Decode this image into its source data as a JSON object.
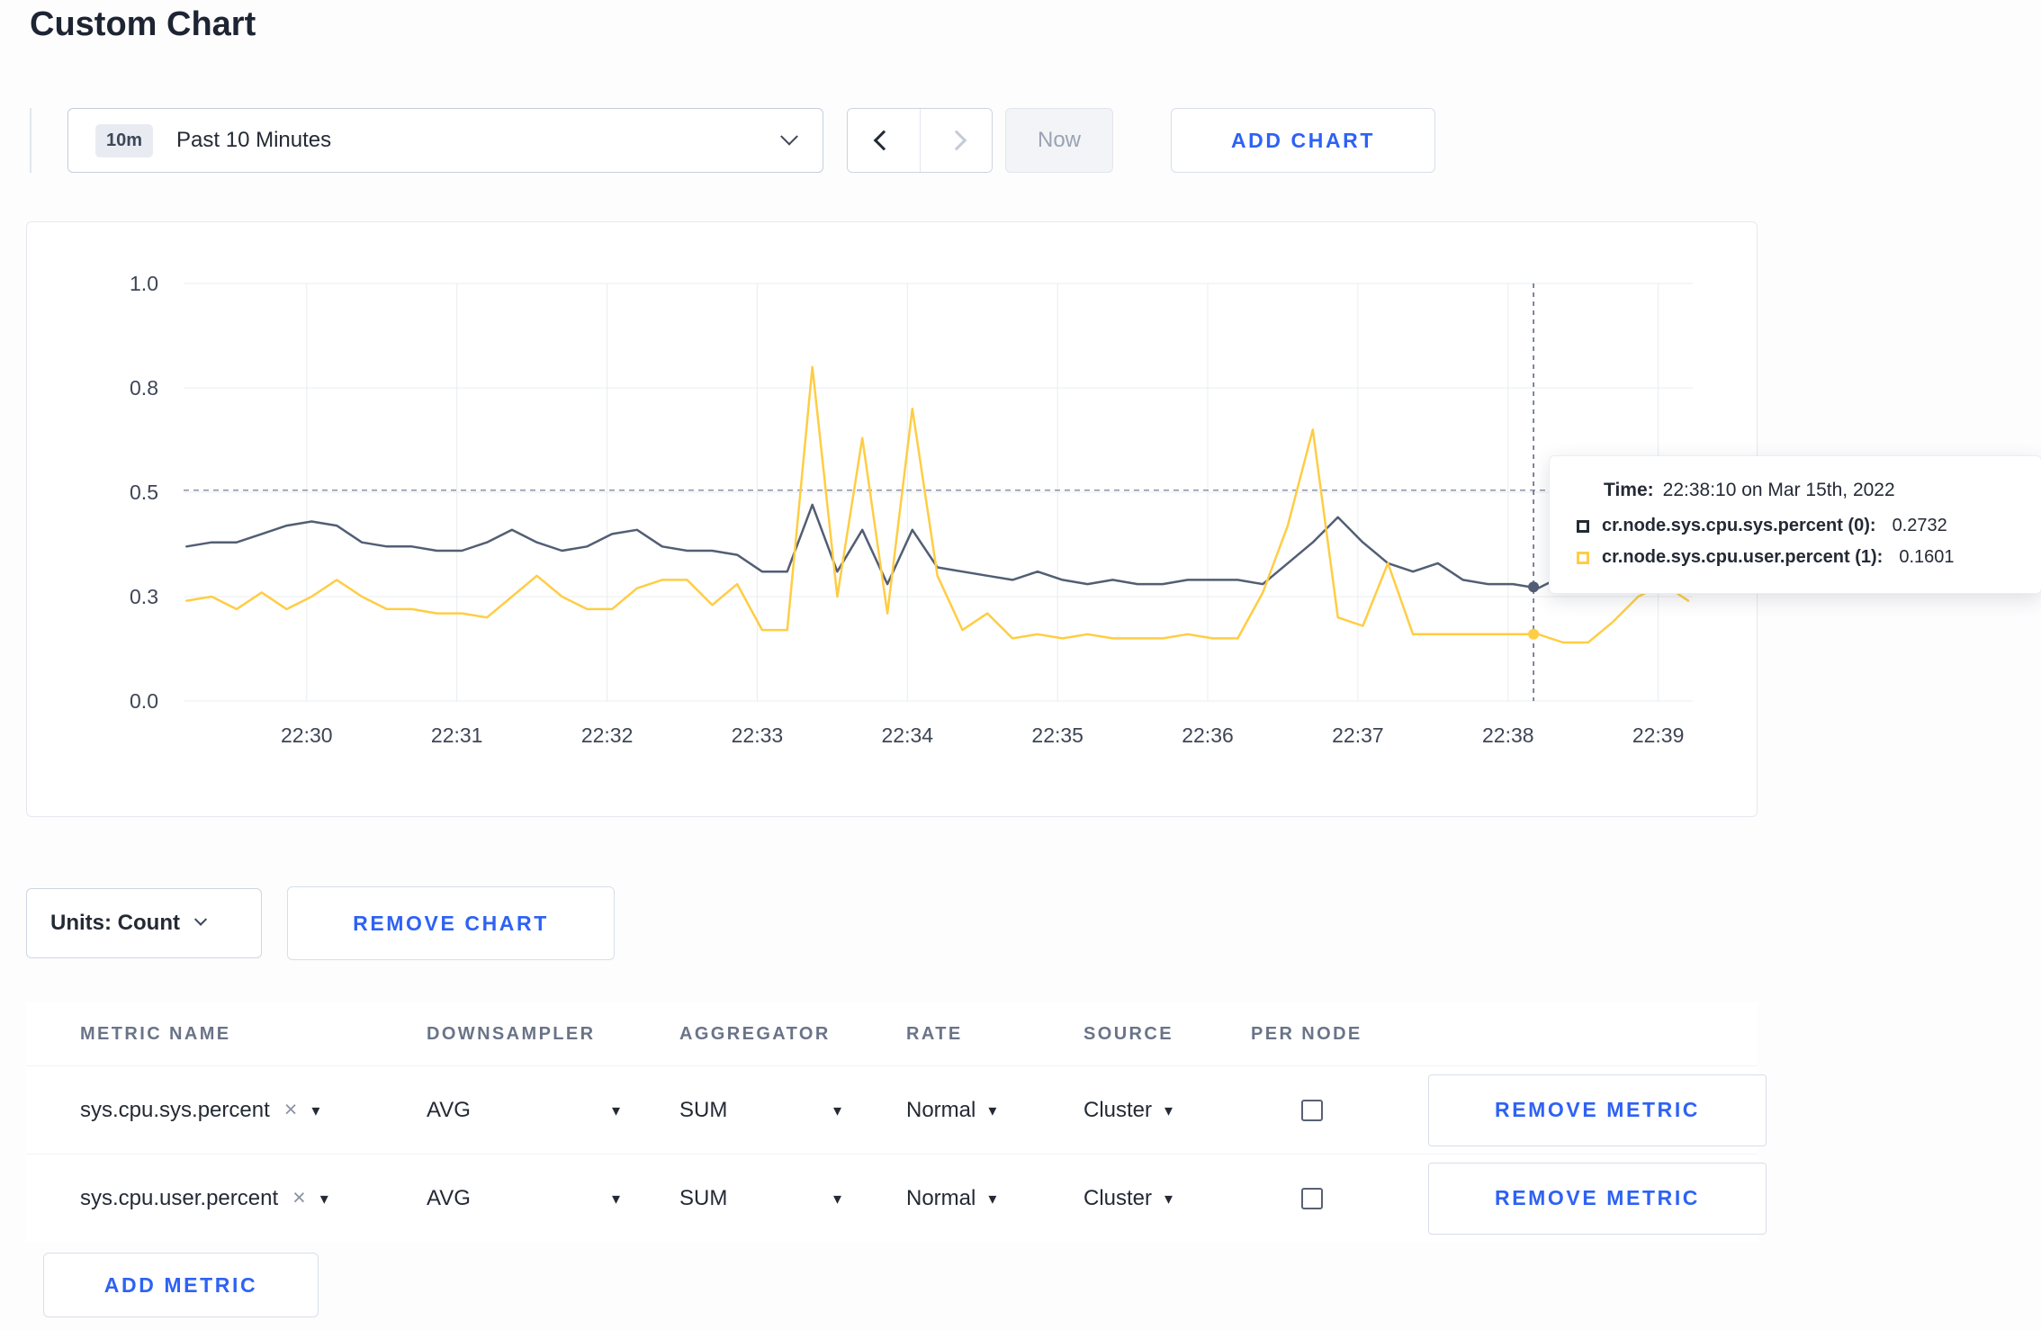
{
  "accent_color": "#2e62f4",
  "page": {
    "title": "Custom Chart"
  },
  "toolbar": {
    "time_range": {
      "badge": "10m",
      "label": "Past 10 Minutes"
    },
    "now_label": "Now",
    "add_chart_label": "ADD CHART"
  },
  "tooltip": {
    "time_label": "Time:",
    "time_value": "22:38:10 on Mar 15th, 2022",
    "series": [
      {
        "name": "cr.node.sys.cpu.sys.percent (0):",
        "value": "0.2732",
        "swatch": "#242a35"
      },
      {
        "name": "cr.node.sys.cpu.user.percent (1):",
        "value": "0.1601",
        "swatch": "#ffcd44"
      }
    ]
  },
  "units_bar": {
    "units_label": "Units: Count",
    "remove_chart_label": "REMOVE CHART"
  },
  "metrics_table": {
    "headers": [
      "METRIC NAME",
      "DOWNSAMPLER",
      "AGGREGATOR",
      "RATE",
      "SOURCE",
      "PER NODE"
    ],
    "rows": [
      {
        "name": "sys.cpu.sys.percent",
        "downsampler": "AVG",
        "aggregator": "SUM",
        "rate": "Normal",
        "source": "Cluster",
        "per_node_checked": false,
        "remove_label": "REMOVE METRIC"
      },
      {
        "name": "sys.cpu.user.percent",
        "downsampler": "AVG",
        "aggregator": "SUM",
        "rate": "Normal",
        "source": "Cluster",
        "per_node_checked": false,
        "remove_label": "REMOVE METRIC"
      }
    ],
    "add_metric_label": "ADD METRIC"
  },
  "chart_data": {
    "type": "line",
    "title": "",
    "x_axis": {
      "tick_labels": [
        "22:30",
        "22:31",
        "22:32",
        "22:33",
        "22:34",
        "22:35",
        "22:36",
        "22:37",
        "22:38",
        "22:39"
      ],
      "tick_minutes": [
        0,
        1,
        2,
        3,
        4,
        5,
        6,
        7,
        8,
        9
      ],
      "domain_minutes": [
        -0.82,
        9.23
      ]
    },
    "y_axis": {
      "tick_labels": [
        "0.0",
        "0.3",
        "0.5",
        "0.8",
        "1.0"
      ],
      "tick_values": [
        0,
        0.25,
        0.5,
        0.75,
        1.0
      ],
      "range": [
        0,
        1
      ]
    },
    "grid": true,
    "threshold_line_value": 0.505,
    "hover": {
      "minute": 8.17,
      "time": "22:38:10"
    },
    "t_minutes": [
      -0.8,
      -0.633,
      -0.467,
      -0.3,
      -0.133,
      0.033,
      0.2,
      0.367,
      0.533,
      0.7,
      0.867,
      1.033,
      1.2,
      1.367,
      1.533,
      1.7,
      1.867,
      2.033,
      2.2,
      2.367,
      2.533,
      2.7,
      2.867,
      3.033,
      3.2,
      3.367,
      3.533,
      3.7,
      3.867,
      4.033,
      4.2,
      4.367,
      4.533,
      4.7,
      4.867,
      5.033,
      5.2,
      5.367,
      5.533,
      5.7,
      5.867,
      6.033,
      6.2,
      6.367,
      6.533,
      6.7,
      6.867,
      7.033,
      7.2,
      7.367,
      7.533,
      7.7,
      7.867,
      8.033,
      8.2,
      8.367,
      8.533,
      8.7,
      8.867,
      9.033,
      9.2
    ],
    "series": [
      {
        "name": "cr.node.sys.cpu.sys.percent",
        "color": "#525e74",
        "hover_value": 0.2732,
        "values": [
          0.37,
          0.38,
          0.38,
          0.4,
          0.42,
          0.43,
          0.42,
          0.38,
          0.37,
          0.37,
          0.36,
          0.36,
          0.38,
          0.41,
          0.38,
          0.36,
          0.37,
          0.4,
          0.41,
          0.37,
          0.36,
          0.36,
          0.35,
          0.31,
          0.31,
          0.47,
          0.31,
          0.41,
          0.28,
          0.41,
          0.32,
          0.31,
          0.3,
          0.29,
          0.31,
          0.29,
          0.28,
          0.29,
          0.28,
          0.28,
          0.29,
          0.29,
          0.29,
          0.28,
          0.33,
          0.38,
          0.44,
          0.38,
          0.33,
          0.31,
          0.33,
          0.29,
          0.28,
          0.28,
          0.27,
          0.3,
          0.31,
          0.29,
          0.3,
          0.31,
          0.33
        ]
      },
      {
        "name": "cr.node.sys.cpu.user.percent",
        "color": "#ffcd44",
        "hover_value": 0.1601,
        "values": [
          0.24,
          0.25,
          0.22,
          0.26,
          0.22,
          0.25,
          0.29,
          0.25,
          0.22,
          0.22,
          0.21,
          0.21,
          0.2,
          0.25,
          0.3,
          0.25,
          0.22,
          0.22,
          0.27,
          0.29,
          0.29,
          0.23,
          0.28,
          0.17,
          0.17,
          0.8,
          0.25,
          0.63,
          0.21,
          0.7,
          0.3,
          0.17,
          0.21,
          0.15,
          0.16,
          0.15,
          0.16,
          0.15,
          0.15,
          0.15,
          0.16,
          0.15,
          0.15,
          0.26,
          0.42,
          0.65,
          0.2,
          0.18,
          0.33,
          0.16,
          0.16,
          0.16,
          0.16,
          0.16,
          0.16,
          0.14,
          0.14,
          0.19,
          0.25,
          0.28,
          0.24
        ]
      }
    ]
  }
}
